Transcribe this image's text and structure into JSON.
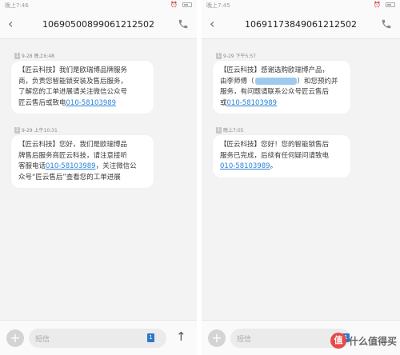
{
  "left": {
    "status_time": "晚上7:46",
    "phone_number": "10690500899061212502",
    "messages": [
      {
        "timestamp": "9-28 晚上6:48",
        "lines": [
          "【匠云科技】我们是欧瑞博品牌服务",
          "商，负责您智能锁安装及售后服务，",
          "了解您的工单进展请关注微信公众号",
          "匠云售后或致电"
        ],
        "link": "010-58103989"
      },
      {
        "timestamp": "9-29 上午10:31",
        "lines": [
          "【匠云科技】您好，我们是欧瑞博品",
          "牌售后服务商匠云科技，请注意接听",
          "客服电话"
        ],
        "link": "010-58103989",
        "lines_after": [
          "，关注微信公",
          "众号“匠云售后”查看您的工单进展"
        ]
      }
    ],
    "composer": {
      "placeholder": "短信",
      "sim_label": "1"
    }
  },
  "right": {
    "status_time": "晚上7:45",
    "phone_number": "10691173849061212502",
    "messages": [
      {
        "timestamp": "9-29 下午5:57",
        "lines": [
          "【匠云科技】感谢选购欧瑞博产品，",
          "由李师傅（",
          "）和您预约并",
          "服务，有问题请联系公众号匠云售后",
          "或"
        ],
        "link": "010-58103989"
      },
      {
        "timestamp": "晚上7:05",
        "lines": [
          "【匠云科技】您好！您的智能锁售后",
          "服务已完成，后续有任何疑问请致电"
        ],
        "link": "010-58103989",
        "link_suffix": "。"
      }
    ],
    "composer": {
      "placeholder": "短信",
      "sim_label": "1"
    }
  },
  "watermark": {
    "logo_char": "值",
    "text": "什么值得买"
  },
  "colors": {
    "link": "#2a82d8",
    "sim_badge": "#2f77c8",
    "alarm": "#e04848"
  }
}
